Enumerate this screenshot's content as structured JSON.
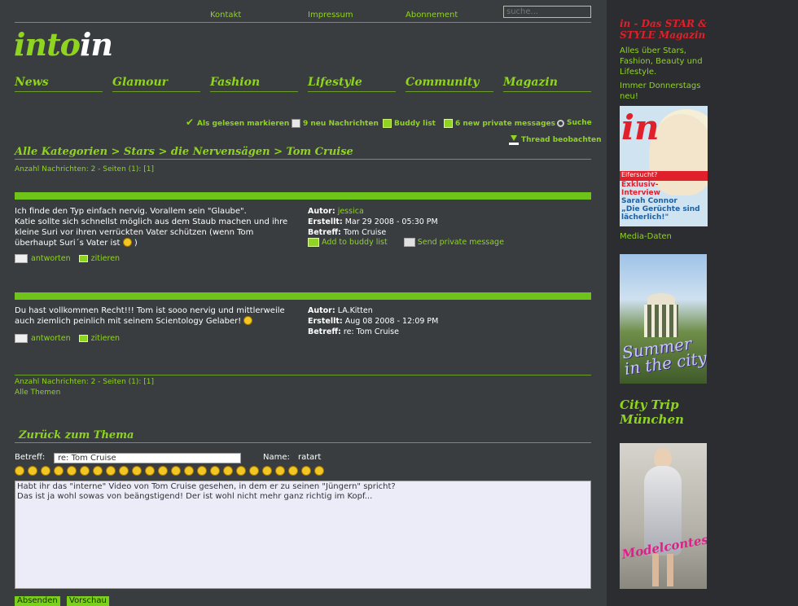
{
  "header": {
    "links": [
      "Kontakt",
      "Impressum",
      "Abonnement"
    ],
    "search_placeholder": "suche...",
    "logo_part1": "into",
    "logo_part2": "in"
  },
  "nav": [
    "News",
    "Glamour",
    "Fashion",
    "Lifestyle",
    "Community",
    "Magazin"
  ],
  "actions": {
    "mark_read": "Als gelesen markieren",
    "new_messages": "9 neu Nachrichten",
    "buddy_list": "Buddy list",
    "private_messages": "6 new private messages",
    "search": "Suche",
    "watch_thread": "Thread beobachten"
  },
  "breadcrumb": "Alle Kategorien > Stars > die Nervensägen > Tom Cruise",
  "page_info": "Anzahl Nachrichten: 2 - Seiten (1): [1]",
  "posts": [
    {
      "text_lines": [
        "Ich finde den Typ einfach nervig. Vorallem sein \"Glaube\".",
        "Katie sollte sich schnellst möglich aus dem Staub machen und ihre",
        "kleine Suri vor ihren verrückten Vater schützen (wenn Tom",
        "überhaupt Suri´s Vater ist"
      ],
      "text_tail": ")",
      "author_label": "Autor:",
      "author": "jessica",
      "created_label": "Erstellt:",
      "created": "Mar 29 2008 - 05:30 PM",
      "subject_label": "Betreff:",
      "subject": "Tom Cruise",
      "add_buddy": "Add to buddy list",
      "send_pm": "Send private message",
      "reply": "antworten",
      "quote": "zitieren"
    },
    {
      "text_lines": [
        "Du hast vollkommen Recht!!! Tom ist sooo nervig und mittlerweile",
        "auch ziemlich peinlich mit seinem Scientology Gelaber!"
      ],
      "author_label": "Autor:",
      "author": "LA.Kitten",
      "created_label": "Erstellt:",
      "created": "Aug 08 2008 - 12:09 PM",
      "subject_label": "Betreff:",
      "subject": "re: Tom Cruise",
      "reply": "antworten",
      "quote": "zitieren"
    }
  ],
  "footer_info": "Anzahl Nachrichten: 2 - Seiten (1): [1]",
  "all_topics": "Alle Themen",
  "reply_form": {
    "title": "Zurück zum Thema",
    "subject_label": "Betreff:",
    "subject_value": "re: Tom Cruise",
    "name_label": "Name:",
    "name_value": "ratart",
    "message": "Habt ihr das \"interne\" Video von Tom Cruise gesehen, in dem er zu seinen \"Jüngern\" spricht?\nDas ist ja wohl sowas von beängstigend! Der ist wohl nicht mehr ganz richtig im Kopf...",
    "submit": "Absenden",
    "preview": "Vorschau"
  },
  "sidebar": {
    "title": "in - Das STAR & STYLE Magazin",
    "desc": "Alles über Stars, Fashion, Beauty und Lifestyle.",
    "schedule": "Immer Donnerstags neu!",
    "media_link": "Media-Daten",
    "magazine_logo": "in",
    "magazine_band": "Eifersucht?",
    "magazine_sub": "Exklusiv-Interview",
    "magazine_name": "Sarah Connor",
    "magazine_quote": "„Die Gerüchte sind lächerlich!\"",
    "ad_summer": "Summer in the city",
    "city_trip": "City Trip München",
    "ad_model": "Modelcontest"
  },
  "colors": {
    "accent": "#8fd41f",
    "background": "#3a3d40",
    "sidebar": "#2b2d30",
    "red": "#e0202a"
  }
}
